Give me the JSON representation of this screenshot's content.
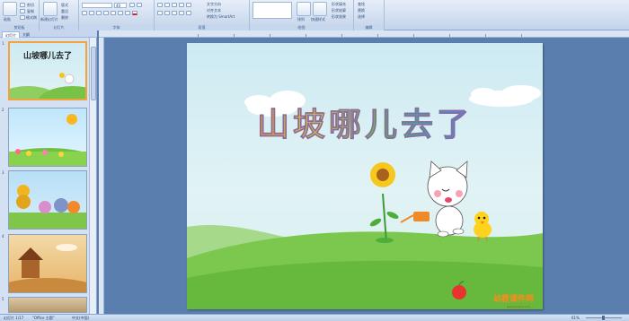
{
  "ribbon": {
    "groups": [
      {
        "label": "剪贴板",
        "items": [
          "粘贴",
          "剪切",
          "复制",
          "格式刷"
        ]
      },
      {
        "label": "幻灯片",
        "items": [
          "新建幻灯片",
          "版式",
          "重设",
          "删除"
        ]
      },
      {
        "label": "字体",
        "items": [],
        "font_size": "40"
      },
      {
        "label": "段落",
        "items": [
          "文字方向",
          "对齐文本",
          "转换为 SmartArt"
        ]
      },
      {
        "label": "绘图",
        "items": [
          "排列",
          "快速样式",
          "形状填充",
          "形状轮廓",
          "形状效果"
        ]
      },
      {
        "label": "编辑",
        "items": [
          "查找",
          "替换",
          "选择"
        ]
      }
    ]
  },
  "panel": {
    "tabs": [
      "幻灯片",
      "大纲"
    ],
    "slides": [
      {
        "num": "1",
        "title": "山坡哪儿去了"
      },
      {
        "num": "2"
      },
      {
        "num": "3"
      },
      {
        "num": "4"
      },
      {
        "num": "5"
      }
    ]
  },
  "slide": {
    "title": "山坡哪儿去了",
    "watermark": "幼教课件网",
    "watermark_sub": "www.youjiao.com"
  },
  "status": {
    "slide_info": "幻灯片 1/17",
    "theme": "\"Office 主题\"",
    "language": "中文(中国)",
    "zoom": "61%"
  },
  "colors": {
    "accent": "#f2a43a",
    "ribbon": "#cfdcee",
    "workspace": "#5a7fae"
  }
}
